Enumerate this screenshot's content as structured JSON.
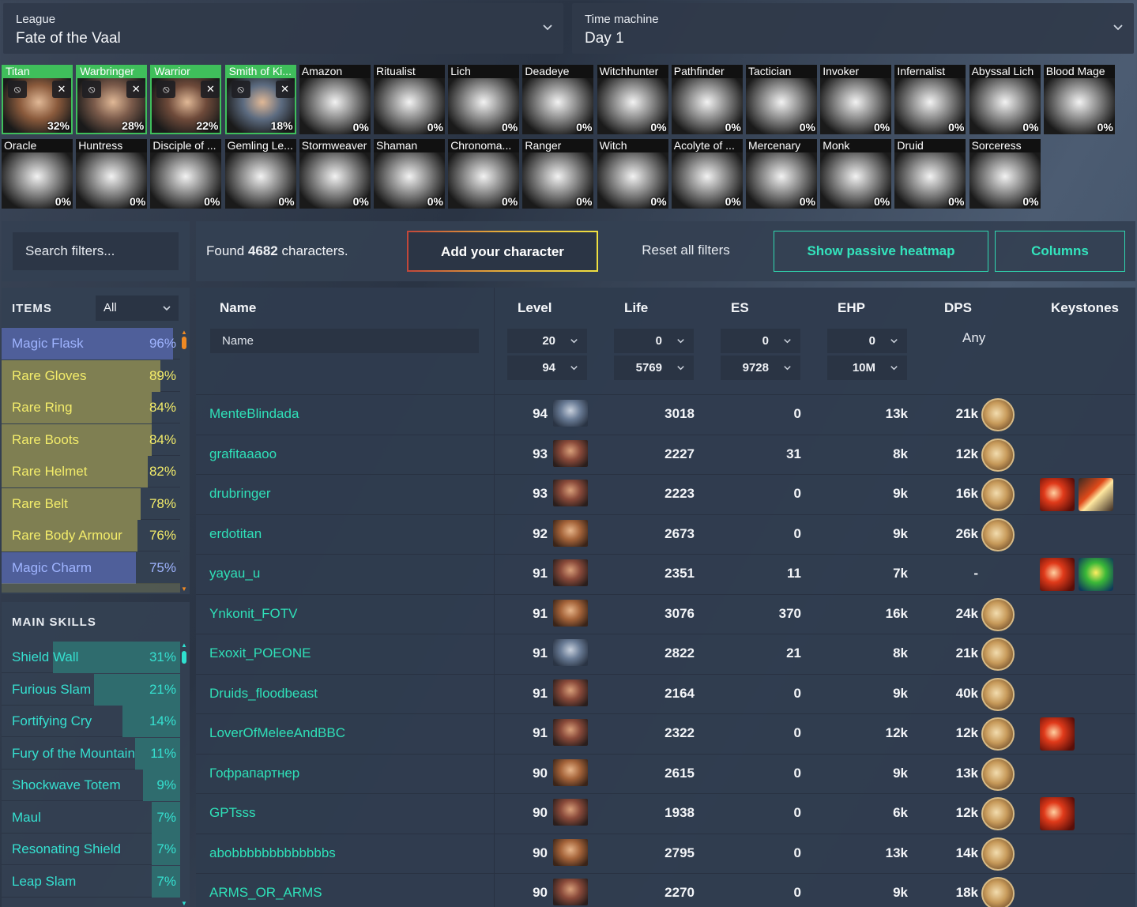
{
  "league": {
    "label": "League",
    "value": "Fate of the Vaal"
  },
  "time_machine": {
    "label": "Time machine",
    "value": "Day 1"
  },
  "classes": [
    {
      "name": "Titan",
      "pct": "32%",
      "selected": true
    },
    {
      "name": "Warbringer",
      "pct": "28%",
      "selected": true
    },
    {
      "name": "Warrior",
      "pct": "22%",
      "selected": true
    },
    {
      "name": "Smith of Ki...",
      "pct": "18%",
      "selected": true
    },
    {
      "name": "Amazon",
      "pct": "0%"
    },
    {
      "name": "Ritualist",
      "pct": "0%"
    },
    {
      "name": "Lich",
      "pct": "0%"
    },
    {
      "name": "Deadeye",
      "pct": "0%"
    },
    {
      "name": "Witchhunter",
      "pct": "0%"
    },
    {
      "name": "Pathfinder",
      "pct": "0%"
    },
    {
      "name": "Tactician",
      "pct": "0%"
    },
    {
      "name": "Invoker",
      "pct": "0%"
    },
    {
      "name": "Infernalist",
      "pct": "0%"
    },
    {
      "name": "Abyssal Lich",
      "pct": "0%"
    },
    {
      "name": "Blood Mage",
      "pct": "0%"
    },
    {
      "name": "Oracle",
      "pct": "0%"
    },
    {
      "name": "Huntress",
      "pct": "0%"
    },
    {
      "name": "Disciple of ...",
      "pct": "0%"
    },
    {
      "name": "Gemling Le...",
      "pct": "0%"
    },
    {
      "name": "Stormweaver",
      "pct": "0%"
    },
    {
      "name": "Shaman",
      "pct": "0%"
    },
    {
      "name": "Chronoma...",
      "pct": "0%"
    },
    {
      "name": "Ranger",
      "pct": "0%"
    },
    {
      "name": "Witch",
      "pct": "0%"
    },
    {
      "name": "Acolyte of ...",
      "pct": "0%"
    },
    {
      "name": "Mercenary",
      "pct": "0%"
    },
    {
      "name": "Monk",
      "pct": "0%"
    },
    {
      "name": "Druid",
      "pct": "0%"
    },
    {
      "name": "Sorceress",
      "pct": "0%"
    }
  ],
  "search": {
    "placeholder": "Search filters..."
  },
  "found": {
    "prefix": "Found ",
    "count": "4682",
    "suffix": " characters."
  },
  "buttons": {
    "add": "Add your character",
    "reset": "Reset all filters",
    "heatmap": "Show passive heatmap",
    "columns": "Columns"
  },
  "items": {
    "title": "ITEMS",
    "filter_value": "All",
    "rows": [
      {
        "name": "Magic Flask",
        "pct": "96%",
        "fill": 0.96,
        "kind": "magic"
      },
      {
        "name": "Rare Gloves",
        "pct": "89%",
        "fill": 0.89,
        "kind": "rare"
      },
      {
        "name": "Rare Ring",
        "pct": "84%",
        "fill": 0.84,
        "kind": "rare"
      },
      {
        "name": "Rare Boots",
        "pct": "84%",
        "fill": 0.84,
        "kind": "rare"
      },
      {
        "name": "Rare Helmet",
        "pct": "82%",
        "fill": 0.82,
        "kind": "rare"
      },
      {
        "name": "Rare Belt",
        "pct": "78%",
        "fill": 0.78,
        "kind": "rare"
      },
      {
        "name": "Rare Body Armour",
        "pct": "76%",
        "fill": 0.76,
        "kind": "rare"
      },
      {
        "name": "Magic Charm",
        "pct": "75%",
        "fill": 0.75,
        "kind": "magic"
      }
    ]
  },
  "skills": {
    "title": "MAIN SKILLS",
    "rows": [
      {
        "name": "Shield Wall",
        "pct": "31%",
        "fill": 0.31
      },
      {
        "name": "Furious Slam",
        "pct": "21%",
        "fill": 0.21
      },
      {
        "name": "Fortifying Cry",
        "pct": "14%",
        "fill": 0.14
      },
      {
        "name": "Fury of the Mountain",
        "pct": "11%",
        "fill": 0.11
      },
      {
        "name": "Shockwave Totem",
        "pct": "9%",
        "fill": 0.09
      },
      {
        "name": "Maul",
        "pct": "7%",
        "fill": 0.07
      },
      {
        "name": "Resonating Shield",
        "pct": "7%",
        "fill": 0.07
      },
      {
        "name": "Leap Slam",
        "pct": "7%",
        "fill": 0.07
      }
    ]
  },
  "table": {
    "headers": {
      "name": "Name",
      "level": "Level",
      "life": "Life",
      "es": "ES",
      "ehp": "EHP",
      "dps": "DPS",
      "keystones": "Keystones"
    },
    "name_placeholder": "Name",
    "level": {
      "min": "20",
      "max": "94"
    },
    "life": {
      "min": "0",
      "max": "5769"
    },
    "es": {
      "min": "0",
      "max": "9728"
    },
    "ehp": {
      "min": "0",
      "max": "10M"
    },
    "dps_filter": "Any",
    "rows": [
      {
        "name": "MenteBlindada",
        "level": "94",
        "life": "3018",
        "es": "0",
        "ehp": "13k",
        "dps": "21k",
        "avatar": "smith",
        "orb": true,
        "keystones": []
      },
      {
        "name": "grafitaaaoo",
        "level": "93",
        "life": "2227",
        "es": "31",
        "ehp": "8k",
        "dps": "12k",
        "avatar": "warbringer",
        "orb": true,
        "keystones": []
      },
      {
        "name": "drubringer",
        "level": "93",
        "life": "2223",
        "es": "0",
        "ehp": "9k",
        "dps": "16k",
        "avatar": "warbringer",
        "orb": true,
        "keystones": [
          "red",
          "fire"
        ]
      },
      {
        "name": "erdotitan",
        "level": "92",
        "life": "2673",
        "es": "0",
        "ehp": "9k",
        "dps": "26k",
        "avatar": "titan",
        "orb": true,
        "keystones": []
      },
      {
        "name": "yayau_u",
        "level": "91",
        "life": "2351",
        "es": "11",
        "ehp": "7k",
        "dps": "-",
        "avatar": "warbringer",
        "orb": false,
        "keystones": [
          "red",
          "green"
        ]
      },
      {
        "name": "Ynkonit_FOTV",
        "level": "91",
        "life": "3076",
        "es": "370",
        "ehp": "16k",
        "dps": "24k",
        "avatar": "titan",
        "orb": true,
        "keystones": []
      },
      {
        "name": "Exoxit_POEONE",
        "level": "91",
        "life": "2822",
        "es": "21",
        "ehp": "8k",
        "dps": "21k",
        "avatar": "smith",
        "orb": true,
        "keystones": []
      },
      {
        "name": "Druids_floodbeast",
        "level": "91",
        "life": "2164",
        "es": "0",
        "ehp": "9k",
        "dps": "40k",
        "avatar": "warbringer",
        "orb": true,
        "keystones": []
      },
      {
        "name": "LoverOfMeleeAndBBC",
        "level": "91",
        "life": "2322",
        "es": "0",
        "ehp": "12k",
        "dps": "12k",
        "avatar": "warbringer",
        "orb": true,
        "keystones": [
          "red"
        ]
      },
      {
        "name": "Гофрапартнер",
        "level": "90",
        "life": "2615",
        "es": "0",
        "ehp": "9k",
        "dps": "13k",
        "avatar": "titan",
        "orb": true,
        "keystones": []
      },
      {
        "name": "GPTsss",
        "level": "90",
        "life": "1938",
        "es": "0",
        "ehp": "6k",
        "dps": "12k",
        "avatar": "warbringer",
        "orb": true,
        "keystones": [
          "red"
        ]
      },
      {
        "name": "abobbbbbbbbbbbbbs",
        "level": "90",
        "life": "2795",
        "es": "0",
        "ehp": "13k",
        "dps": "14k",
        "avatar": "titan",
        "orb": true,
        "keystones": []
      },
      {
        "name": "ARMS_OR_ARMS",
        "level": "90",
        "life": "2270",
        "es": "0",
        "ehp": "9k",
        "dps": "18k",
        "avatar": "warbringer",
        "orb": true,
        "keystones": []
      }
    ]
  },
  "colors": {
    "accent": "#2fe0b8",
    "selected_class": "#3fbf5b",
    "magic_bar": "#4f5f9a",
    "rare_bar": "#7f7f52",
    "skill_bar": "#2f6c6e"
  }
}
